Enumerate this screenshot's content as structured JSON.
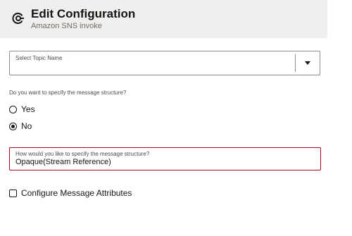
{
  "header": {
    "title": "Edit Configuration",
    "subtitle": "Amazon SNS invoke",
    "icon": "adapter-endpoint-icon"
  },
  "topic_select": {
    "label": "Select Topic Name",
    "value": ""
  },
  "message_structure": {
    "question": "Do you want to specify the message structure?",
    "options": [
      {
        "label": "Yes",
        "checked": false
      },
      {
        "label": "No",
        "checked": true
      }
    ]
  },
  "structure_type": {
    "label": "How would you like to specify the message structure?",
    "value": "Opaque(Stream Reference)"
  },
  "attributes": {
    "label": "Configure Message Attributes",
    "checked": false
  },
  "colors": {
    "header_bg": "#f1efed",
    "error_border": "#b3001e",
    "text": "#161513"
  }
}
